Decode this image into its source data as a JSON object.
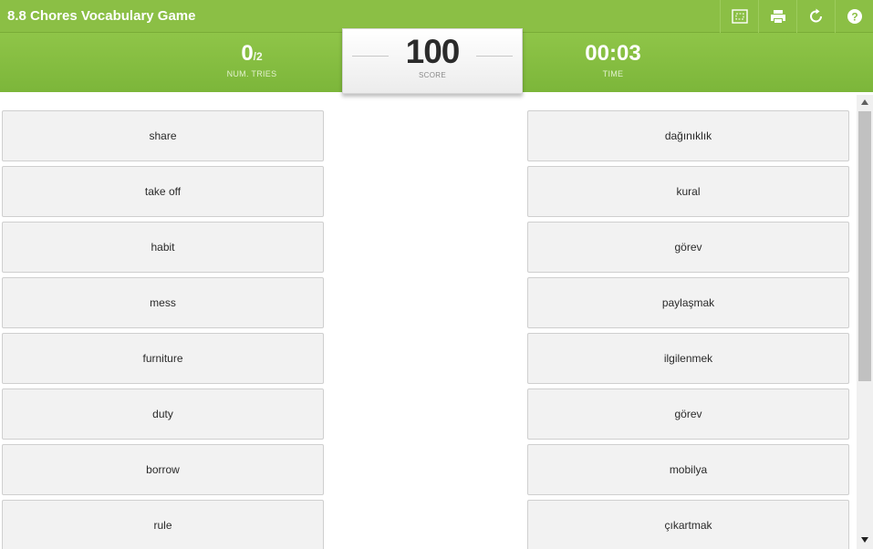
{
  "header": {
    "title": "8.8 Chores Vocabulary Game",
    "buttons": [
      {
        "icon": "fullscreen-icon"
      },
      {
        "icon": "print-icon"
      },
      {
        "icon": "restart-icon"
      },
      {
        "icon": "help-icon"
      }
    ]
  },
  "stats": {
    "tries_value": "0",
    "tries_total": "/2",
    "tries_label": "NUM. TRIES",
    "score_value": "100",
    "score_label": "SCORE",
    "time_value": "00:03",
    "time_label": "TIME"
  },
  "left_cards": [
    "share",
    "take off",
    "habit",
    "mess",
    "furniture",
    "duty",
    "borrow",
    "rule"
  ],
  "right_cards": [
    "dağınıklık",
    "kural",
    "görev",
    "paylaşmak",
    "ilgilenmek",
    "görev",
    "mobilya",
    "çıkartmak"
  ],
  "colors": {
    "header_green": "#8bbf45",
    "card_bg": "#f2f2f2",
    "card_border": "#cfcfcf"
  }
}
